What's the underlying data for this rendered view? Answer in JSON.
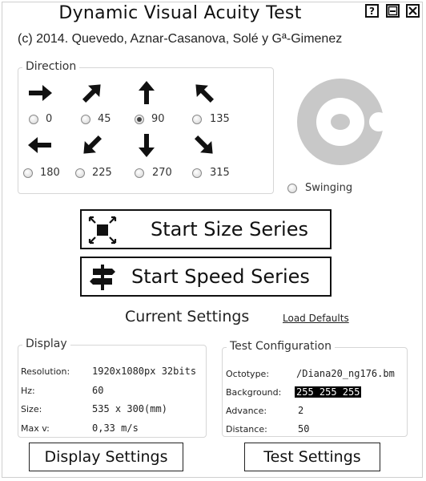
{
  "window": {
    "title": "Dynamic Visual Acuity Test",
    "buttons": {
      "help": "?",
      "minimize": "minimize",
      "close": "close"
    }
  },
  "copyright": "(c) 2014. Quevedo, Aznar-Casanova, Solé y Gª-Gimenez",
  "direction": {
    "legend": "Direction",
    "options": [
      {
        "label": "0",
        "icon": "arrow-right-icon",
        "checked": false
      },
      {
        "label": "45",
        "icon": "arrow-up-right-icon",
        "checked": false
      },
      {
        "label": "90",
        "icon": "arrow-up-icon",
        "checked": true
      },
      {
        "label": "135",
        "icon": "arrow-up-left-icon",
        "checked": false
      },
      {
        "label": "180",
        "icon": "arrow-left-icon",
        "checked": false
      },
      {
        "label": "225",
        "icon": "arrow-down-left-icon",
        "checked": false
      },
      {
        "label": "270",
        "icon": "arrow-down-icon",
        "checked": false
      },
      {
        "label": "315",
        "icon": "arrow-down-right-icon",
        "checked": false
      }
    ],
    "swinging": {
      "label": "Swinging",
      "icon": "swinging-target-icon",
      "checked": false
    }
  },
  "actions": {
    "size_series": {
      "label": "Start Size Series",
      "icon": "shrink-square-icon"
    },
    "speed_series": {
      "label": "Start Speed Series",
      "icon": "signpost-icon"
    }
  },
  "current_settings": {
    "title": "Current Settings",
    "load_defaults": "Load Defaults"
  },
  "display": {
    "legend": "Display",
    "rows": [
      {
        "key": "Resolution:",
        "value": "1920x1080px 32bits"
      },
      {
        "key": "Hz:",
        "value": "60"
      },
      {
        "key": "Size:",
        "value": "535 x 300(mm)"
      },
      {
        "key": "Max v:",
        "value": "0,33 m/s"
      }
    ]
  },
  "test_configuration": {
    "legend": "Test Configuration",
    "rows": [
      {
        "key": "Octotype:",
        "value": "/Diana20_ng176.bm"
      },
      {
        "key": "Background:",
        "value": "255 255 255"
      },
      {
        "key": "Advance:",
        "value": "2"
      },
      {
        "key": "Distance:",
        "value": "50"
      }
    ]
  },
  "footer": {
    "display_settings": "Display Settings",
    "test_settings": "Test Settings"
  },
  "colors": {
    "swing_target": "#c8c8c8",
    "text": "#111111",
    "highlight_bg": "#000000"
  }
}
